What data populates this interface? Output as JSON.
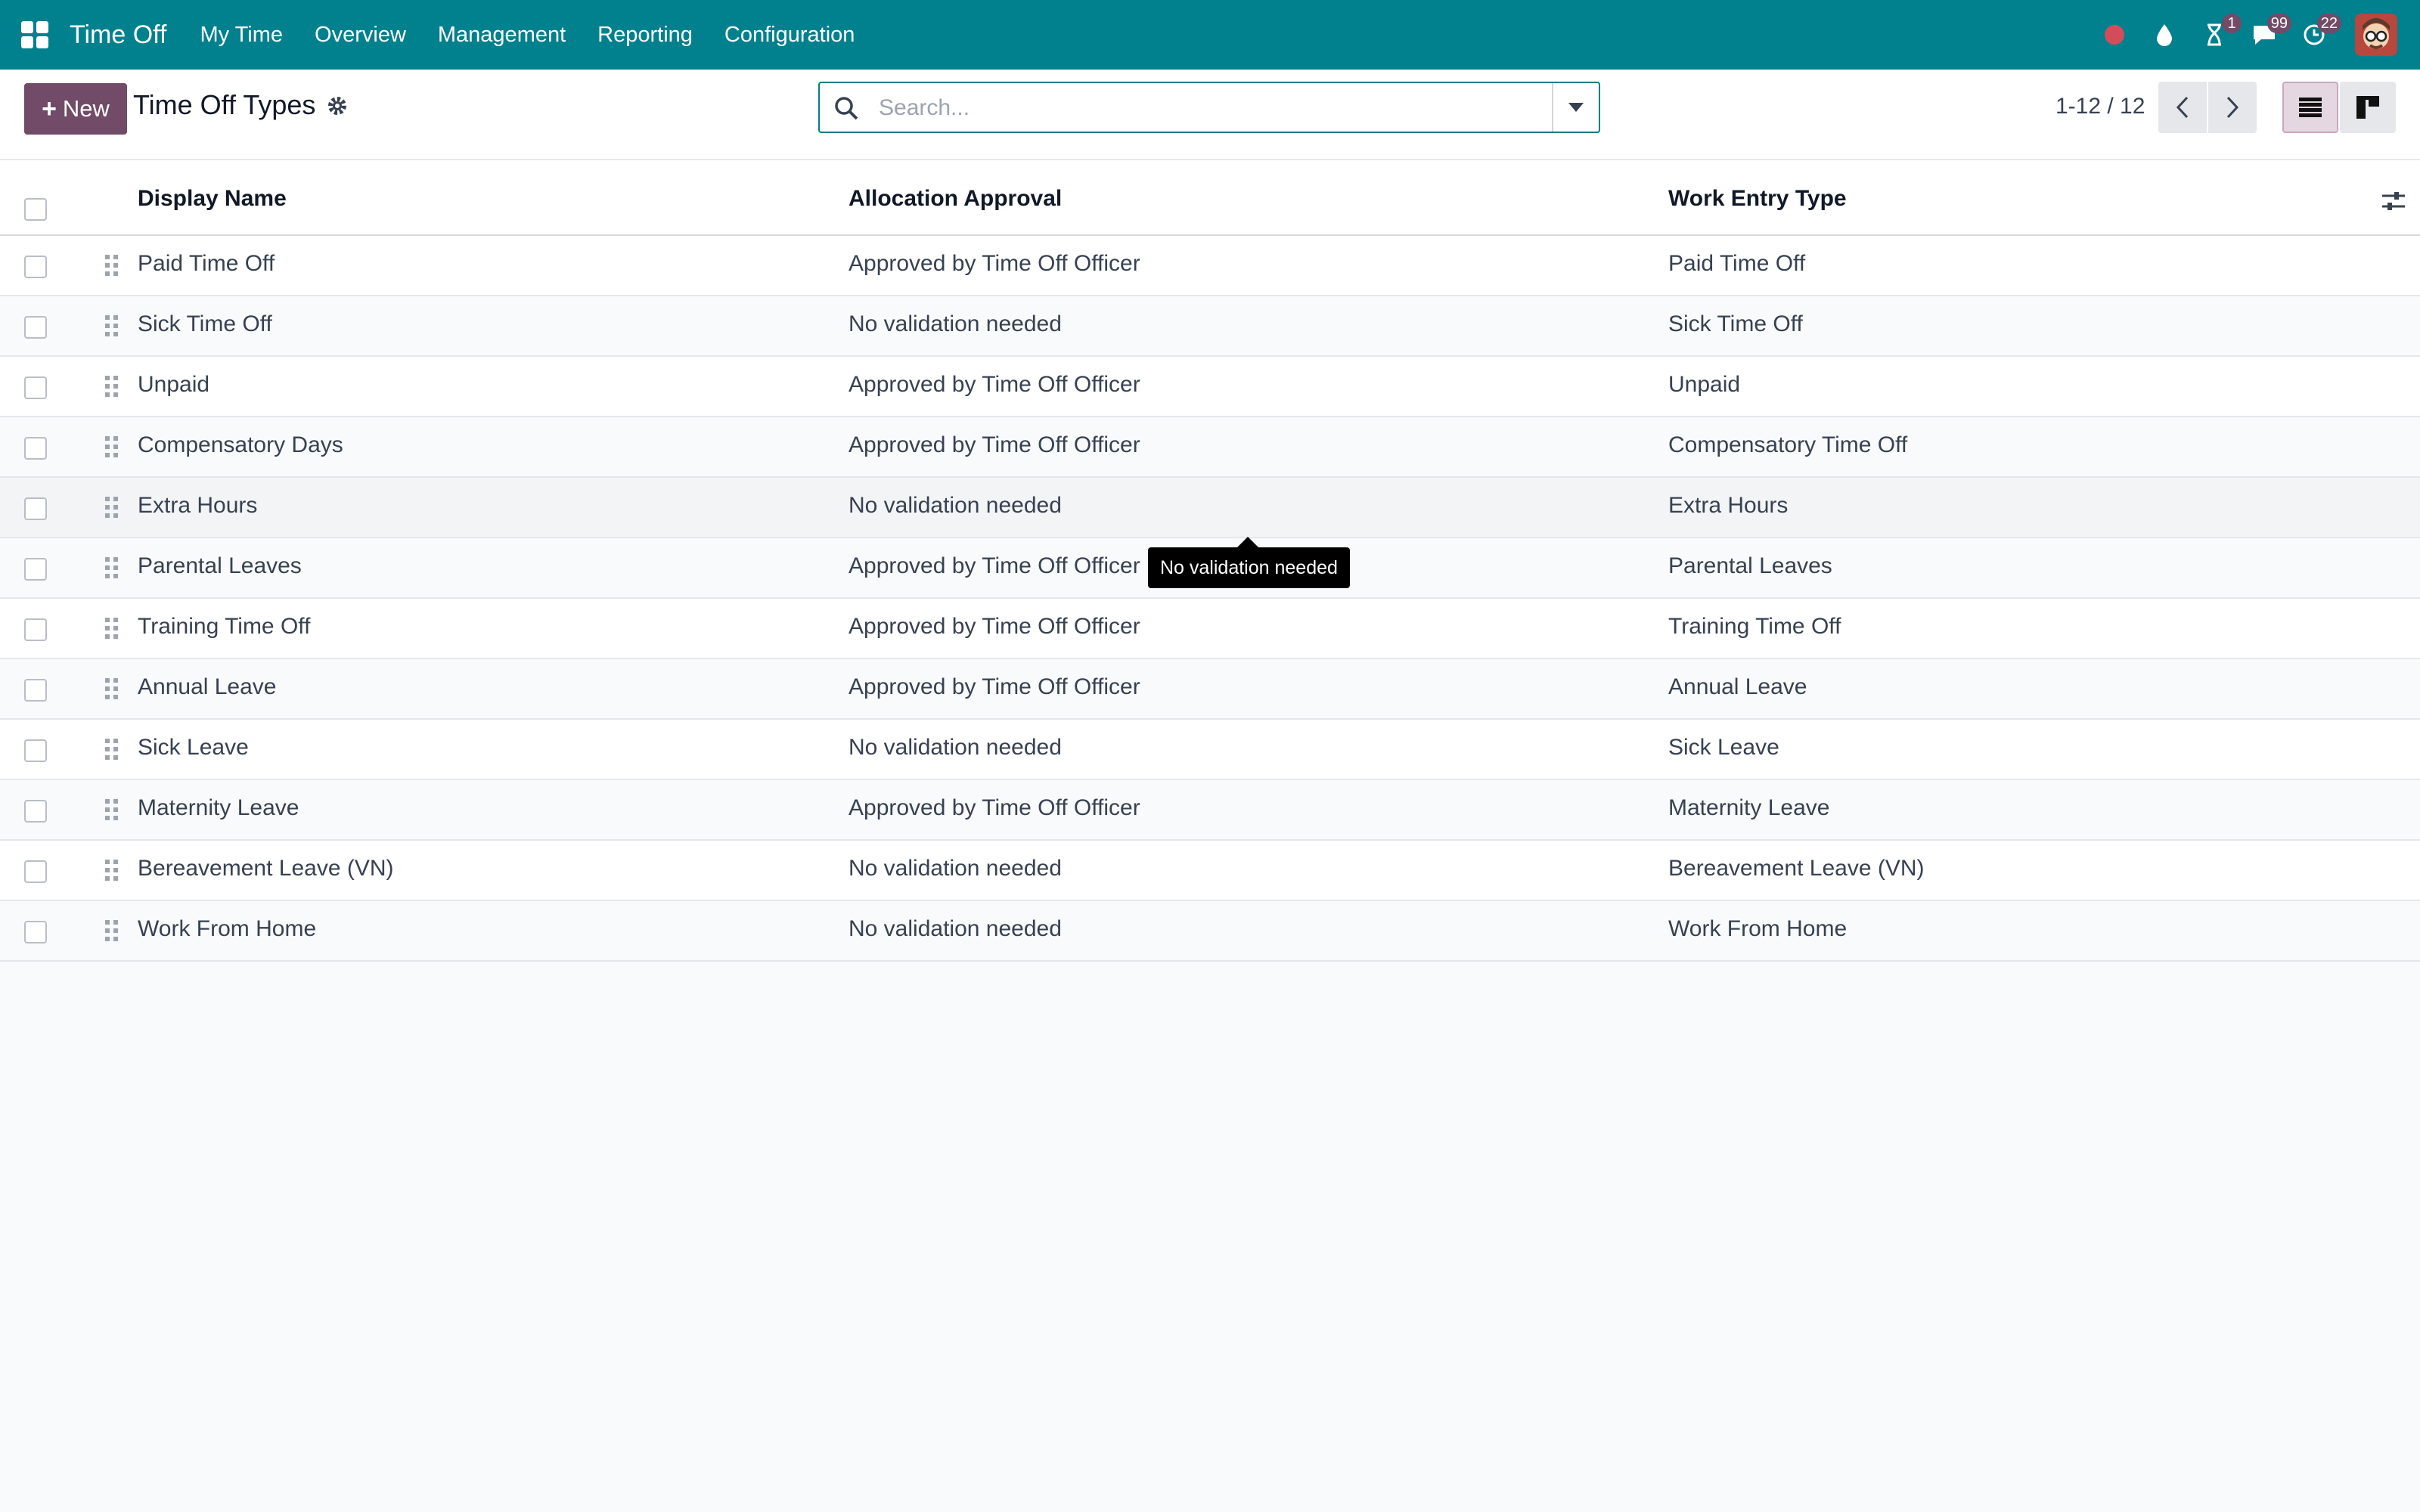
{
  "navbar": {
    "app_title": "Time Off",
    "menu": [
      "My Time",
      "Overview",
      "Management",
      "Reporting",
      "Configuration"
    ],
    "badges": {
      "activity": "1",
      "messages": "99",
      "timer": "22"
    },
    "colors": {
      "navbar": "#01808e",
      "primary": "#714b67"
    }
  },
  "control": {
    "new_label": "New",
    "breadcrumb": "Time Off Types",
    "search_placeholder": "Search...",
    "pager": "1-12 / 12"
  },
  "table": {
    "columns": [
      "Display Name",
      "Allocation Approval",
      "Work Entry Type"
    ],
    "rows": [
      [
        "Paid Time Off",
        "Approved by Time Off Officer",
        "Paid Time Off"
      ],
      [
        "Sick Time Off",
        "No validation needed",
        "Sick Time Off"
      ],
      [
        "Unpaid",
        "Approved by Time Off Officer",
        "Unpaid"
      ],
      [
        "Compensatory Days",
        "Approved by Time Off Officer",
        "Compensatory Time Off"
      ],
      [
        "Extra Hours",
        "No validation needed",
        "Extra Hours"
      ],
      [
        "Parental Leaves",
        "Approved by Time Off Officer",
        "Parental Leaves"
      ],
      [
        "Training Time Off",
        "Approved by Time Off Officer",
        "Training Time Off"
      ],
      [
        "Annual Leave",
        "Approved by Time Off Officer",
        "Annual Leave"
      ],
      [
        "Sick Leave",
        "No validation needed",
        "Sick Leave"
      ],
      [
        "Maternity Leave",
        "Approved by Time Off Officer",
        "Maternity Leave"
      ],
      [
        "Bereavement Leave (VN)",
        "No validation needed",
        "Bereavement Leave (VN)"
      ],
      [
        "Work From Home",
        "No validation needed",
        "Work From Home"
      ]
    ]
  },
  "tooltip": "No validation needed"
}
